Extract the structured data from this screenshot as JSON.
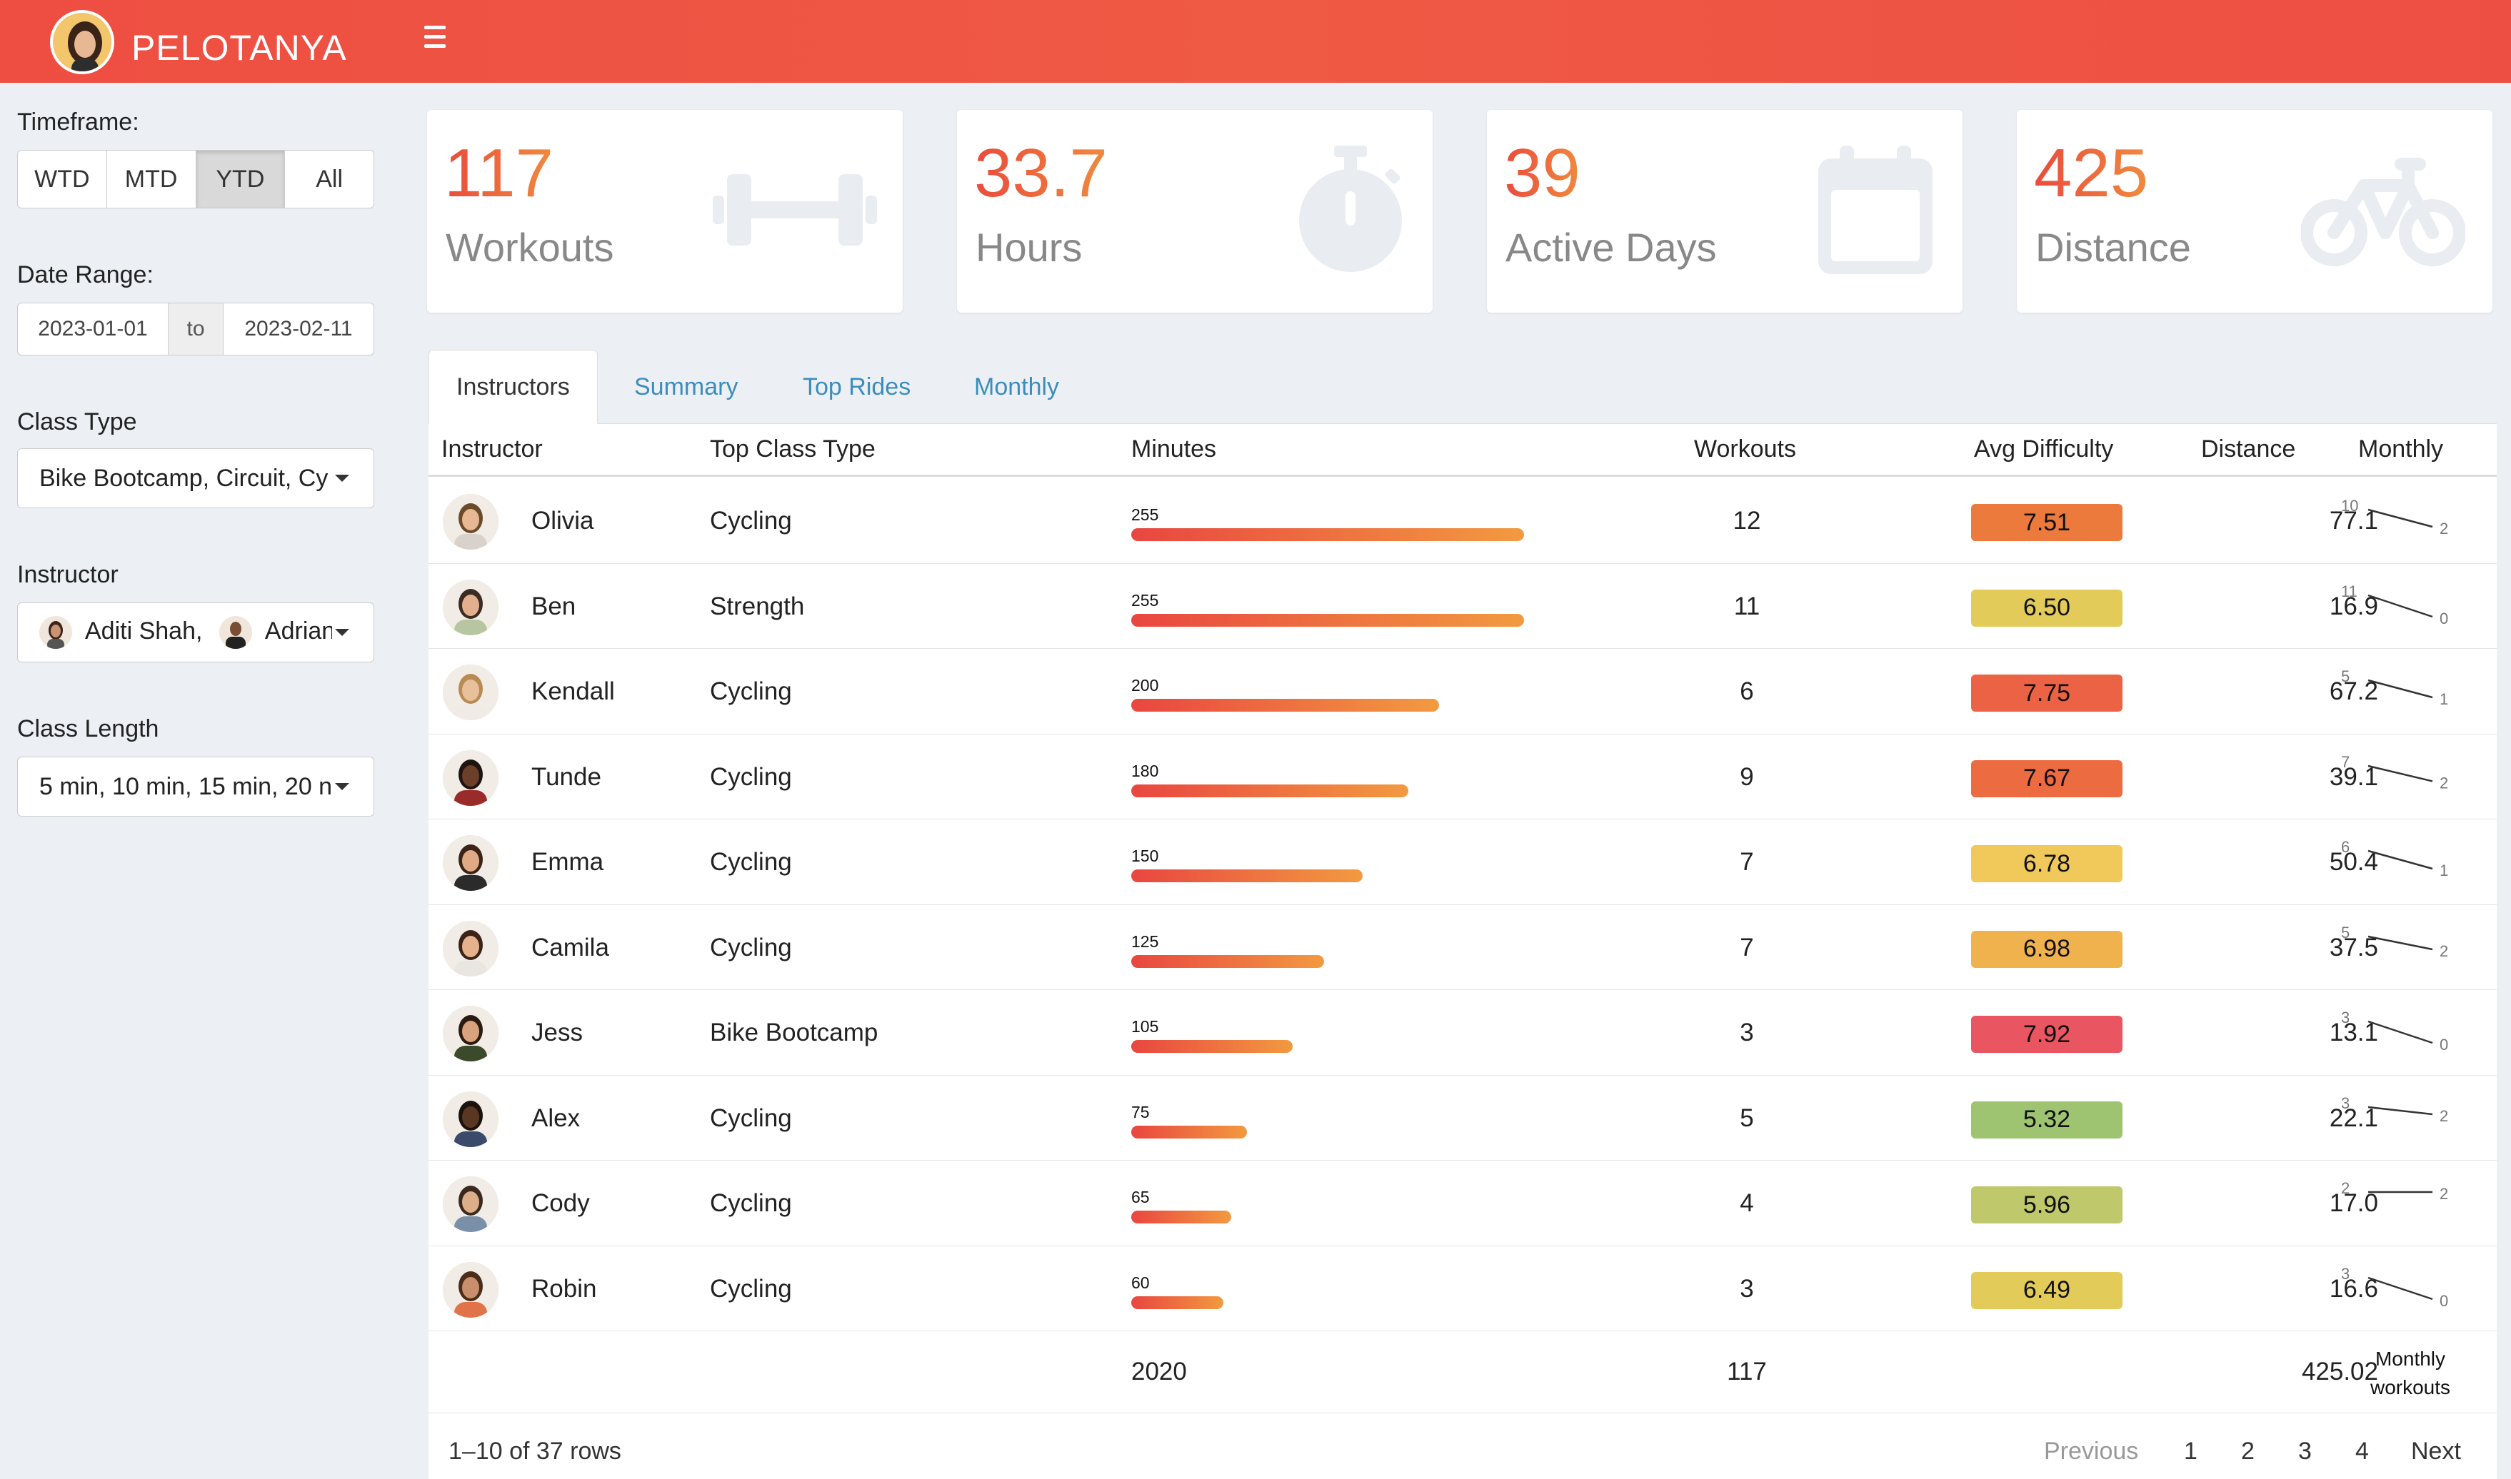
{
  "header": {
    "brand": "PELOTANYA"
  },
  "sidebar": {
    "timeframe_label": "Timeframe:",
    "timeframe_options": [
      "WTD",
      "MTD",
      "YTD",
      "All"
    ],
    "timeframe_selected": "YTD",
    "date_range_label": "Date Range:",
    "date_start": "2023-01-01",
    "date_to": "to",
    "date_end": "2023-02-11",
    "class_type_label": "Class Type",
    "class_type_value": "Bike Bootcamp, Circuit, Cy",
    "instructor_label": "Instructor",
    "instructor_value_1": "Aditi Shah,",
    "instructor_value_2": "Adrian",
    "class_length_label": "Class Length",
    "class_length_value": "5 min, 10 min, 15 min, 20 n"
  },
  "stats": [
    {
      "value": "117",
      "label": "Workouts",
      "icon": "dumbbell-icon"
    },
    {
      "value": "33.7",
      "label": "Hours",
      "icon": "stopwatch-icon"
    },
    {
      "value": "39",
      "label": "Active Days",
      "icon": "calendar-icon"
    },
    {
      "value": "425",
      "label": "Distance",
      "icon": "bicycle-icon"
    }
  ],
  "tabs": [
    "Instructors",
    "Summary",
    "Top Rides",
    "Monthly"
  ],
  "table": {
    "headers": [
      "Instructor",
      "Top Class Type",
      "Minutes",
      "Workouts",
      "Avg Difficulty",
      "Distance",
      "Monthly"
    ],
    "max_minutes": 255,
    "rows": [
      {
        "name": "Olivia",
        "class_type": "Cycling",
        "minutes": "255",
        "minutes_value": 255,
        "workouts": "12",
        "difficulty": "7.51",
        "diff_color": "#ec7a3c",
        "distance": "77.1",
        "spark_start": "10",
        "spark_end": "2",
        "spark_values": [
          10,
          2
        ]
      },
      {
        "name": "Ben",
        "class_type": "Strength",
        "minutes": "255",
        "minutes_value": 255,
        "workouts": "11",
        "difficulty": "6.50",
        "diff_color": "#e3cb5a",
        "distance": "16.9",
        "spark_start": "11",
        "spark_end": "0",
        "spark_values": [
          11,
          0
        ]
      },
      {
        "name": "Kendall",
        "class_type": "Cycling",
        "minutes": "200",
        "minutes_value": 200,
        "workouts": "6",
        "difficulty": "7.75",
        "diff_color": "#eb6244",
        "distance": "67.2",
        "spark_start": "5",
        "spark_end": "1",
        "spark_values": [
          5,
          1
        ]
      },
      {
        "name": "Tunde",
        "class_type": "Cycling",
        "minutes": "180",
        "minutes_value": 180,
        "workouts": "9",
        "difficulty": "7.67",
        "diff_color": "#ec6b40",
        "distance": "39.1",
        "spark_start": "7",
        "spark_end": "2",
        "spark_values": [
          7,
          2
        ]
      },
      {
        "name": "Emma",
        "class_type": "Cycling",
        "minutes": "150",
        "minutes_value": 150,
        "workouts": "7",
        "difficulty": "6.78",
        "diff_color": "#f0c95a",
        "distance": "50.4",
        "spark_start": "6",
        "spark_end": "1",
        "spark_values": [
          6,
          1
        ]
      },
      {
        "name": "Camila",
        "class_type": "Cycling",
        "minutes": "125",
        "minutes_value": 125,
        "workouts": "7",
        "difficulty": "6.98",
        "diff_color": "#f0b24c",
        "distance": "37.5",
        "spark_start": "5",
        "spark_end": "2",
        "spark_values": [
          5,
          2
        ]
      },
      {
        "name": "Jess",
        "class_type": "Bike Bootcamp",
        "minutes": "105",
        "minutes_value": 105,
        "workouts": "3",
        "difficulty": "7.92",
        "diff_color": "#e95560",
        "distance": "13.1",
        "spark_start": "3",
        "spark_end": "0",
        "spark_values": [
          3,
          0
        ]
      },
      {
        "name": "Alex",
        "class_type": "Cycling",
        "minutes": "75",
        "minutes_value": 75,
        "workouts": "5",
        "difficulty": "5.32",
        "diff_color": "#9ec471",
        "distance": "22.1",
        "spark_start": "3",
        "spark_end": "2",
        "spark_values": [
          3,
          2
        ]
      },
      {
        "name": "Cody",
        "class_type": "Cycling",
        "minutes": "65",
        "minutes_value": 65,
        "workouts": "4",
        "difficulty": "5.96",
        "diff_color": "#bfc86a",
        "distance": "17.0",
        "spark_start": "2",
        "spark_end": "2",
        "spark_values": [
          2,
          2
        ]
      },
      {
        "name": "Robin",
        "class_type": "Cycling",
        "minutes": "60",
        "minutes_value": 60,
        "workouts": "3",
        "difficulty": "6.49",
        "diff_color": "#e3cb5a",
        "distance": "16.6",
        "spark_start": "3",
        "spark_end": "0",
        "spark_values": [
          3,
          0
        ]
      }
    ],
    "footer": {
      "minutes_total": "2020",
      "workouts_total": "117",
      "distance_total": "425.02",
      "monthly_line1": "Monthly",
      "monthly_line2": "workouts"
    }
  },
  "pagination": {
    "info": "1–10 of 37 rows",
    "previous": "Previous",
    "pages": [
      "1",
      "2",
      "3",
      "4"
    ],
    "next": "Next"
  }
}
